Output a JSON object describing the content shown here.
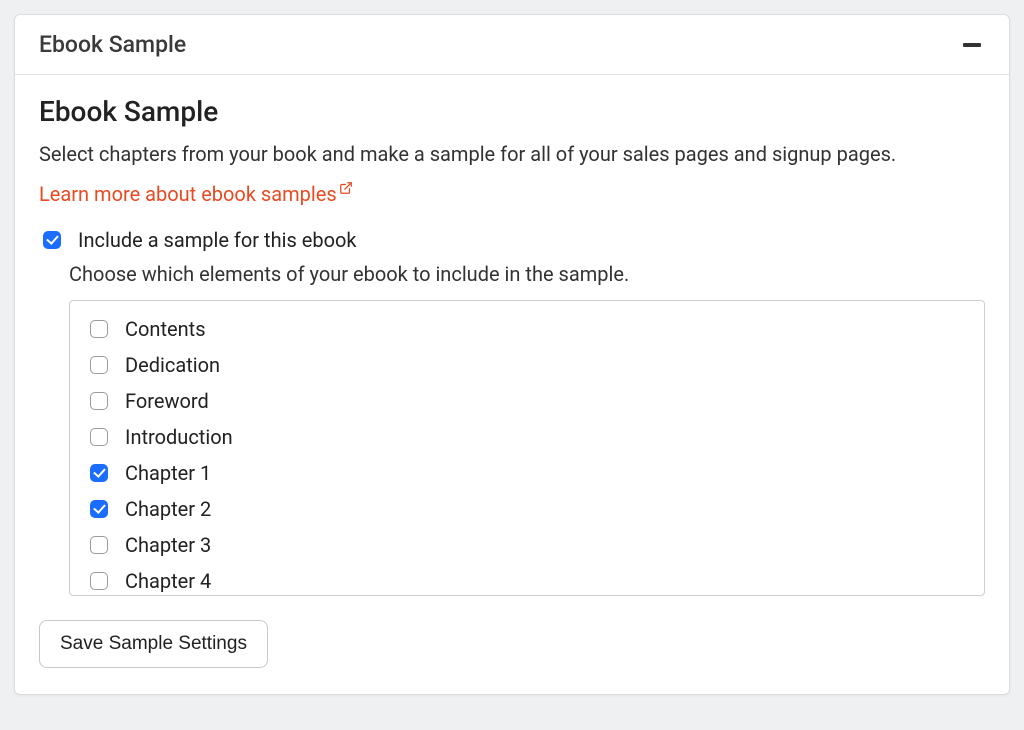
{
  "panel": {
    "header_title": "Ebook Sample",
    "title": "Ebook Sample",
    "description": "Select chapters from your book and make a sample for all of your sales pages and signup pages.",
    "learn_more": "Learn more about ebook samples",
    "include_checkbox_label": "Include a sample for this ebook",
    "include_checked": true,
    "choose_text": "Choose which elements of your ebook to include in the sample.",
    "save_button": "Save Sample Settings"
  },
  "chapters": [
    {
      "label": "Contents",
      "checked": false
    },
    {
      "label": "Dedication",
      "checked": false
    },
    {
      "label": "Foreword",
      "checked": false
    },
    {
      "label": "Introduction",
      "checked": false
    },
    {
      "label": "Chapter 1",
      "checked": true
    },
    {
      "label": "Chapter 2",
      "checked": true
    },
    {
      "label": "Chapter 3",
      "checked": false
    },
    {
      "label": "Chapter 4",
      "checked": false
    }
  ]
}
